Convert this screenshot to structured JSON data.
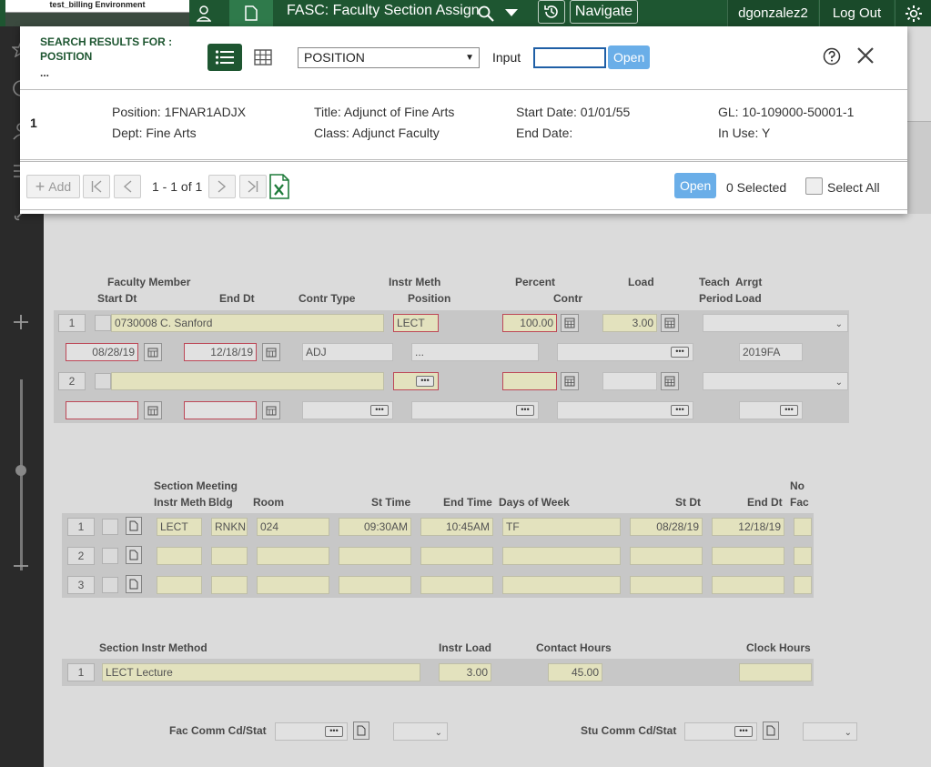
{
  "topbar": {
    "environment": "test_billing Environment",
    "app_title": "FASC: Faculty Section Assignment",
    "navigate": "Navigate",
    "user": "dgonzalez2",
    "logout": "Log Out"
  },
  "modal": {
    "search_results_for": "SEARCH RESULTS FOR :",
    "search_field": "POSITION",
    "search_ellipsis": "...",
    "select_value": "POSITION",
    "input_label": "Input",
    "input_value": "",
    "open_label": "Open",
    "result": {
      "row_num": "1",
      "position": "Position: 1FNAR1ADJX",
      "dept": "Dept: Fine Arts",
      "title": "Title: Adjunct of Fine Arts",
      "class": "Class: Adjunct Faculty",
      "start_date": "Start Date: 01/01/55",
      "end_date": "End Date:",
      "gl": "GL: 10-109000-50001-1",
      "in_use": "In Use: Y"
    },
    "footer": {
      "add": "Add",
      "page_info": "1 - 1 of 1",
      "open_label": "Open",
      "selected": "0 Selected",
      "select_all": "Select All"
    }
  },
  "faculty": {
    "headers": {
      "faculty_member": "Faculty Member",
      "start_dt": "Start Dt",
      "end_dt": "End Dt",
      "contr_type": "Contr Type",
      "instr_meth": "Instr Meth",
      "position": "Position",
      "percent": "Percent",
      "contr": "Contr",
      "load": "Load",
      "teach_period": "Teach Period",
      "arrgt_load": "Arrgt Load",
      "teach": "Teach",
      "period": "Period",
      "arrgt": "Arrgt",
      "load2": "Load"
    },
    "row1": {
      "num": "1",
      "member": "0730008 C. Sanford",
      "instr_meth": "LECT",
      "percent": "100.00",
      "load": "3.00",
      "start_dt": "08/28/19",
      "end_dt": "12/18/19",
      "contr_type": "ADJ",
      "position": "...",
      "arrgt": "2019FA"
    },
    "row2": {
      "num": "2"
    }
  },
  "meetings": {
    "headers": {
      "section_meeting": "Section Meeting",
      "instr_meth": "Instr Meth",
      "bldg": "Bldg",
      "room": "Room",
      "st_time": "St Time",
      "end_time": "End Time",
      "days": "Days of Week",
      "st_dt": "St Dt",
      "end_dt": "End Dt",
      "no": "No",
      "fac": "Fac"
    },
    "rows": [
      {
        "num": "1",
        "meth": "LECT",
        "bldg": "RNKN",
        "room": "024",
        "st_time": "09:30AM",
        "end_time": "10:45AM",
        "days": "TF",
        "st_dt": "08/28/19",
        "end_dt": "12/18/19"
      },
      {
        "num": "2",
        "meth": "",
        "bldg": "",
        "room": "",
        "st_time": "",
        "end_time": "",
        "days": "",
        "st_dt": "",
        "end_dt": ""
      },
      {
        "num": "3",
        "meth": "",
        "bldg": "",
        "room": "",
        "st_time": "",
        "end_time": "",
        "days": "",
        "st_dt": "",
        "end_dt": ""
      }
    ]
  },
  "instr_method": {
    "headers": {
      "section_instr_method": "Section Instr Method",
      "instr_load": "Instr Load",
      "contact_hours": "Contact Hours",
      "clock_hours": "Clock Hours"
    },
    "row": {
      "num": "1",
      "method": "LECT Lecture",
      "instr_load": "3.00",
      "contact_hours": "45.00",
      "clock_hours": ""
    }
  },
  "comm": {
    "fac_label": "Fac Comm Cd/Stat",
    "stu_label": "Stu Comm Cd/Stat"
  },
  "colors": {
    "brand": "#1e5631",
    "accent_blue": "#6aaee8",
    "field_yellow": "#f1f0c9"
  }
}
